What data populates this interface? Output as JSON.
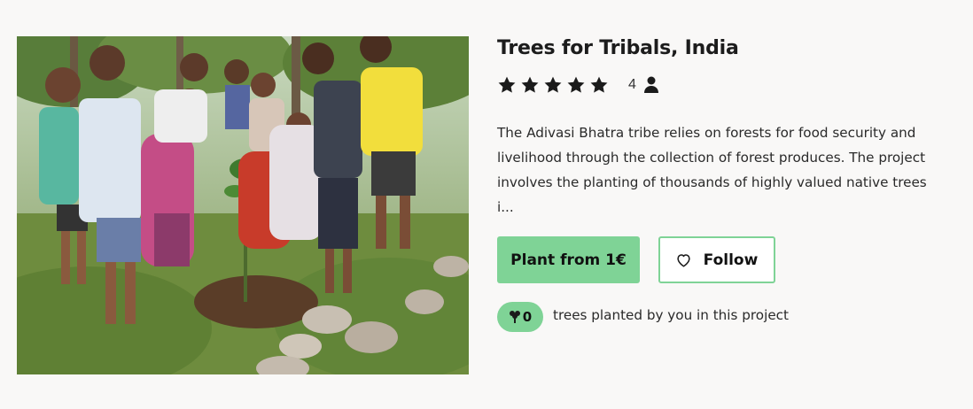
{
  "project": {
    "title": "Trees for Tribals, India",
    "rating_stars": 5,
    "rating_count": "4",
    "description": "The Adivasi Bhatra tribe relies on forests for food security and livelihood through the collection of forest produces. The project involves the planting of thousands of highly valued native trees i...",
    "image_icon": "photo-villagers-planting-tree"
  },
  "actions": {
    "plant_label": "Plant from 1€",
    "follow_label": "Follow",
    "follow_icon": "heart-icon"
  },
  "trees": {
    "count": "0",
    "icon": "tree-icon",
    "note": "trees planted by you in this project"
  },
  "colors": {
    "accent": "#7fd396",
    "background": "#f9f8f7",
    "text": "#222222"
  }
}
